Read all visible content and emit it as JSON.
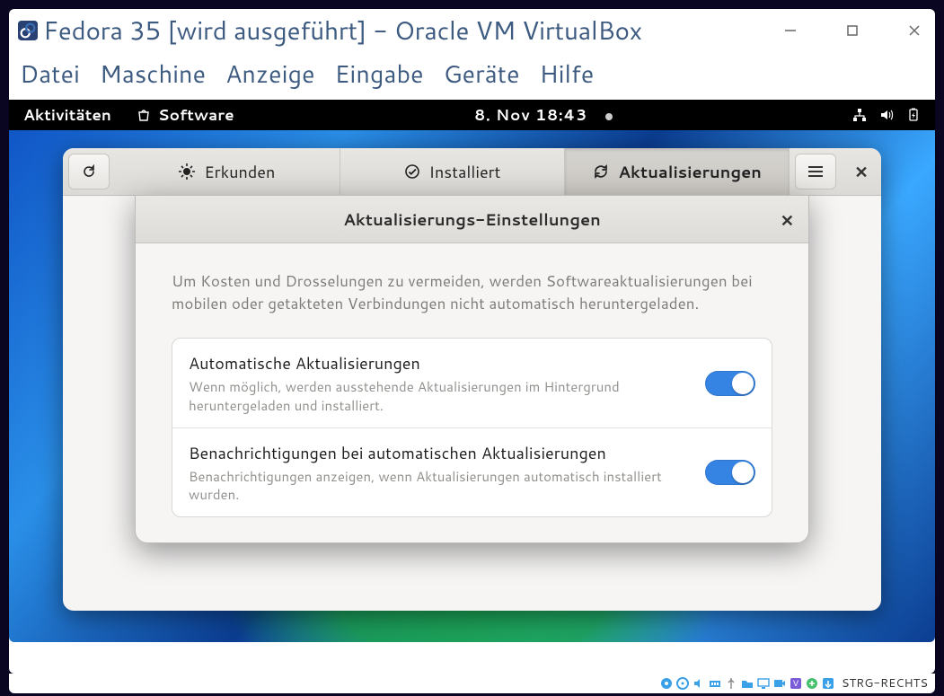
{
  "host": {
    "title": "Fedora 35 [wird ausgeführt] - Oracle VM VirtualBox",
    "menu": [
      "Datei",
      "Maschine",
      "Anzeige",
      "Eingabe",
      "Geräte",
      "Hilfe"
    ],
    "status_key": "STRG-RECHTS"
  },
  "gnome": {
    "activities": "Aktivitäten",
    "app_name": "Software",
    "clock": "8. Nov  18:43"
  },
  "software": {
    "tabs": {
      "explore": "Erkunden",
      "installed": "Installiert",
      "updates": "Aktualisierungen"
    }
  },
  "dialog": {
    "title": "Aktualisierungs-Einstellungen",
    "intro": "Um Kosten und Drosselungen zu vermeiden, werden Softwareaktualisierungen bei mobilen oder getakteten Verbindungen nicht automatisch heruntergeladen.",
    "settings": [
      {
        "title": "Automatische Aktualisierungen",
        "desc": "Wenn möglich, werden ausstehende Aktualisierungen im Hintergrund heruntergeladen und installiert.",
        "on": true
      },
      {
        "title": "Benachrichtigungen bei automatischen Aktualisierungen",
        "desc": "Benachrichtigungen anzeigen, wenn Aktualisierungen automatisch installiert wurden.",
        "on": true
      }
    ]
  }
}
